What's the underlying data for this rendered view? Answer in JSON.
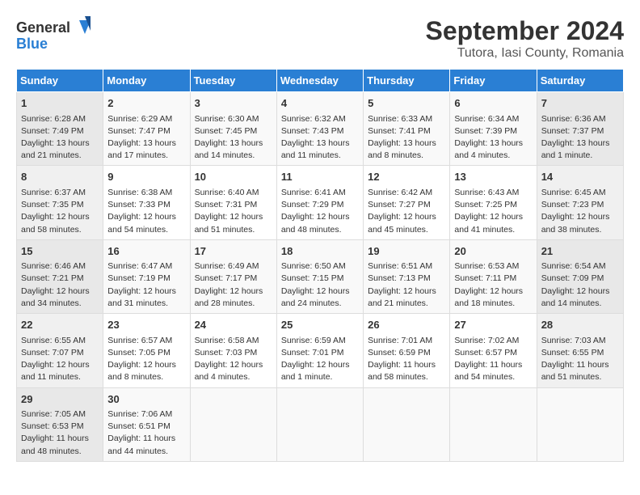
{
  "header": {
    "logo_general": "General",
    "logo_blue": "Blue",
    "title": "September 2024",
    "subtitle": "Tutora, Iasi County, Romania"
  },
  "weekdays": [
    "Sunday",
    "Monday",
    "Tuesday",
    "Wednesday",
    "Thursday",
    "Friday",
    "Saturday"
  ],
  "weeks": [
    [
      {
        "day": "1",
        "sunrise": "6:28 AM",
        "sunset": "7:49 PM",
        "daylight": "13 hours and 21 minutes."
      },
      {
        "day": "2",
        "sunrise": "6:29 AM",
        "sunset": "7:47 PM",
        "daylight": "13 hours and 17 minutes."
      },
      {
        "day": "3",
        "sunrise": "6:30 AM",
        "sunset": "7:45 PM",
        "daylight": "13 hours and 14 minutes."
      },
      {
        "day": "4",
        "sunrise": "6:32 AM",
        "sunset": "7:43 PM",
        "daylight": "13 hours and 11 minutes."
      },
      {
        "day": "5",
        "sunrise": "6:33 AM",
        "sunset": "7:41 PM",
        "daylight": "13 hours and 8 minutes."
      },
      {
        "day": "6",
        "sunrise": "6:34 AM",
        "sunset": "7:39 PM",
        "daylight": "13 hours and 4 minutes."
      },
      {
        "day": "7",
        "sunrise": "6:36 AM",
        "sunset": "7:37 PM",
        "daylight": "13 hours and 1 minute."
      }
    ],
    [
      {
        "day": "8",
        "sunrise": "6:37 AM",
        "sunset": "7:35 PM",
        "daylight": "12 hours and 58 minutes."
      },
      {
        "day": "9",
        "sunrise": "6:38 AM",
        "sunset": "7:33 PM",
        "daylight": "12 hours and 54 minutes."
      },
      {
        "day": "10",
        "sunrise": "6:40 AM",
        "sunset": "7:31 PM",
        "daylight": "12 hours and 51 minutes."
      },
      {
        "day": "11",
        "sunrise": "6:41 AM",
        "sunset": "7:29 PM",
        "daylight": "12 hours and 48 minutes."
      },
      {
        "day": "12",
        "sunrise": "6:42 AM",
        "sunset": "7:27 PM",
        "daylight": "12 hours and 45 minutes."
      },
      {
        "day": "13",
        "sunrise": "6:43 AM",
        "sunset": "7:25 PM",
        "daylight": "12 hours and 41 minutes."
      },
      {
        "day": "14",
        "sunrise": "6:45 AM",
        "sunset": "7:23 PM",
        "daylight": "12 hours and 38 minutes."
      }
    ],
    [
      {
        "day": "15",
        "sunrise": "6:46 AM",
        "sunset": "7:21 PM",
        "daylight": "12 hours and 34 minutes."
      },
      {
        "day": "16",
        "sunrise": "6:47 AM",
        "sunset": "7:19 PM",
        "daylight": "12 hours and 31 minutes."
      },
      {
        "day": "17",
        "sunrise": "6:49 AM",
        "sunset": "7:17 PM",
        "daylight": "12 hours and 28 minutes."
      },
      {
        "day": "18",
        "sunrise": "6:50 AM",
        "sunset": "7:15 PM",
        "daylight": "12 hours and 24 minutes."
      },
      {
        "day": "19",
        "sunrise": "6:51 AM",
        "sunset": "7:13 PM",
        "daylight": "12 hours and 21 minutes."
      },
      {
        "day": "20",
        "sunrise": "6:53 AM",
        "sunset": "7:11 PM",
        "daylight": "12 hours and 18 minutes."
      },
      {
        "day": "21",
        "sunrise": "6:54 AM",
        "sunset": "7:09 PM",
        "daylight": "12 hours and 14 minutes."
      }
    ],
    [
      {
        "day": "22",
        "sunrise": "6:55 AM",
        "sunset": "7:07 PM",
        "daylight": "12 hours and 11 minutes."
      },
      {
        "day": "23",
        "sunrise": "6:57 AM",
        "sunset": "7:05 PM",
        "daylight": "12 hours and 8 minutes."
      },
      {
        "day": "24",
        "sunrise": "6:58 AM",
        "sunset": "7:03 PM",
        "daylight": "12 hours and 4 minutes."
      },
      {
        "day": "25",
        "sunrise": "6:59 AM",
        "sunset": "7:01 PM",
        "daylight": "12 hours and 1 minute."
      },
      {
        "day": "26",
        "sunrise": "7:01 AM",
        "sunset": "6:59 PM",
        "daylight": "11 hours and 58 minutes."
      },
      {
        "day": "27",
        "sunrise": "7:02 AM",
        "sunset": "6:57 PM",
        "daylight": "11 hours and 54 minutes."
      },
      {
        "day": "28",
        "sunrise": "7:03 AM",
        "sunset": "6:55 PM",
        "daylight": "11 hours and 51 minutes."
      }
    ],
    [
      {
        "day": "29",
        "sunrise": "7:05 AM",
        "sunset": "6:53 PM",
        "daylight": "11 hours and 48 minutes."
      },
      {
        "day": "30",
        "sunrise": "7:06 AM",
        "sunset": "6:51 PM",
        "daylight": "11 hours and 44 minutes."
      },
      null,
      null,
      null,
      null,
      null
    ]
  ]
}
